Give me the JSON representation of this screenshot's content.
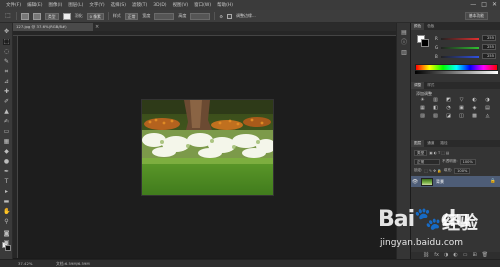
{
  "menu": [
    "文件(F)",
    "编辑(E)",
    "图像(I)",
    "图层(L)",
    "文字(Y)",
    "选择(S)",
    "滤镜(T)",
    "3D(D)",
    "视图(V)",
    "窗口(W)",
    "帮助(H)"
  ],
  "window_controls": [
    "—",
    "□",
    "✕"
  ],
  "options": {
    "mode": "类型",
    "feather_label": "羽化",
    "feather_value": "0 像素",
    "antialias": "消除锯齿",
    "style_label": "样式",
    "style_value": "正常",
    "width_label": "宽度",
    "height_label": "高度",
    "refine": "调整边缘...",
    "workspace": "基本功能"
  },
  "document": {
    "tab_title": "127.jpg @ 37.6%(RGB/8#)",
    "close": "×",
    "zoom": "37.42%",
    "info": "文档:6.59M/6.59M"
  },
  "panels": {
    "color_tabs": [
      "颜色",
      "色板"
    ],
    "rgb": [
      {
        "label": "R",
        "value": "255",
        "color": "#e03030"
      },
      {
        "label": "G",
        "value": "255",
        "color": "#30c030"
      },
      {
        "label": "B",
        "value": "255",
        "color": "#3050e0"
      }
    ],
    "adjust_tabs": [
      "调整",
      "样式"
    ],
    "adjust_title": "添加调整",
    "adjust_icons": [
      "☀",
      "▥",
      "◩",
      "▽",
      "◐",
      "◑",
      "▦",
      "◧",
      "◔",
      "▣",
      "◈",
      "▤",
      "▨",
      "▧",
      "◪",
      "◫",
      "▩",
      "◬"
    ],
    "layer_tabs": [
      "图层",
      "通道",
      "路径"
    ],
    "kind": "类型",
    "blend": "正常",
    "opacity_label": "不透明度:",
    "opacity": "100%",
    "lock_label": "锁定:",
    "fill_label": "填充:",
    "fill": "100%",
    "layer_name": "背景",
    "footer_icons": [
      "⛓",
      "fx",
      "◑",
      "◐",
      "▭",
      "⊞",
      "🗑"
    ]
  },
  "watermark": {
    "logo": "Bai",
    "paw": "🐾",
    "logo_end": "du",
    "suffix": "经验",
    "url": "jingyan.baidu.com"
  }
}
